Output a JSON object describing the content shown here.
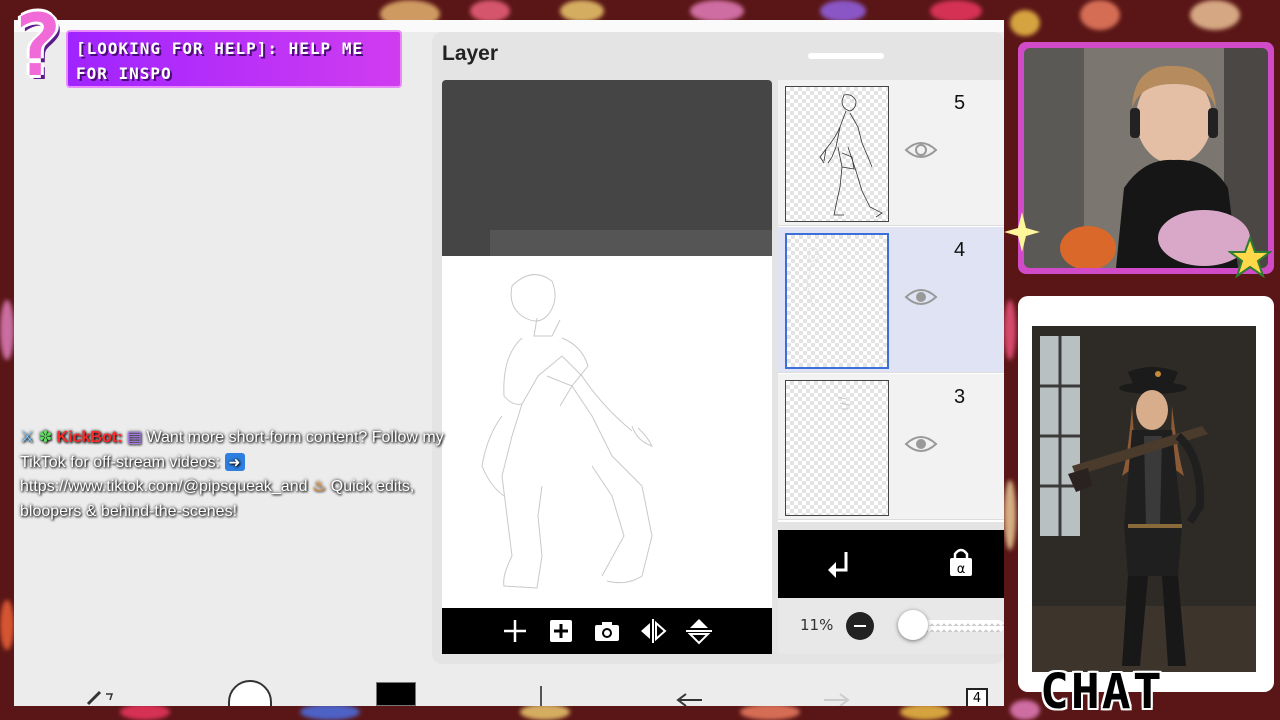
{
  "stream_overlay": {
    "title": "[LOOKiNG FOR HELP]: HELP ME FOR iNSPO",
    "chat_label": "CHAT"
  },
  "chat_message": {
    "username": "KickBot:",
    "text_line1": "Want more short-form content? Follow my",
    "text_line2": "TikTok for off-stream videos:",
    "url": "https://www.tiktok.com/@pipsqueak_and",
    "text_tail": "Quick edits,",
    "text_line4": "bloopers & behind-the-scenes!"
  },
  "layer_panel": {
    "title": "Layer",
    "layers": [
      {
        "number": "5",
        "selected": false
      },
      {
        "number": "4",
        "selected": true
      },
      {
        "number": "3",
        "selected": false
      }
    ],
    "opacity_value": "11%",
    "opacity_level": 0.11
  },
  "preview_toolbar": {
    "icons": [
      "plus-icon",
      "add-layer-icon",
      "camera-icon",
      "flip-horizontal-icon",
      "flip-vertical-icon"
    ]
  },
  "layer_actions": {
    "icons": [
      "merge-down-icon",
      "alpha-lock-icon"
    ]
  },
  "bottom_toolbar": {
    "layer_count": "4"
  },
  "colors": {
    "selected_layer": "#dfe3f3",
    "selected_border": "#3d6fd8",
    "title_purple": "#a024ff",
    "chat_username": "#ff2a2a",
    "frame_pink": "#d14bc8"
  }
}
